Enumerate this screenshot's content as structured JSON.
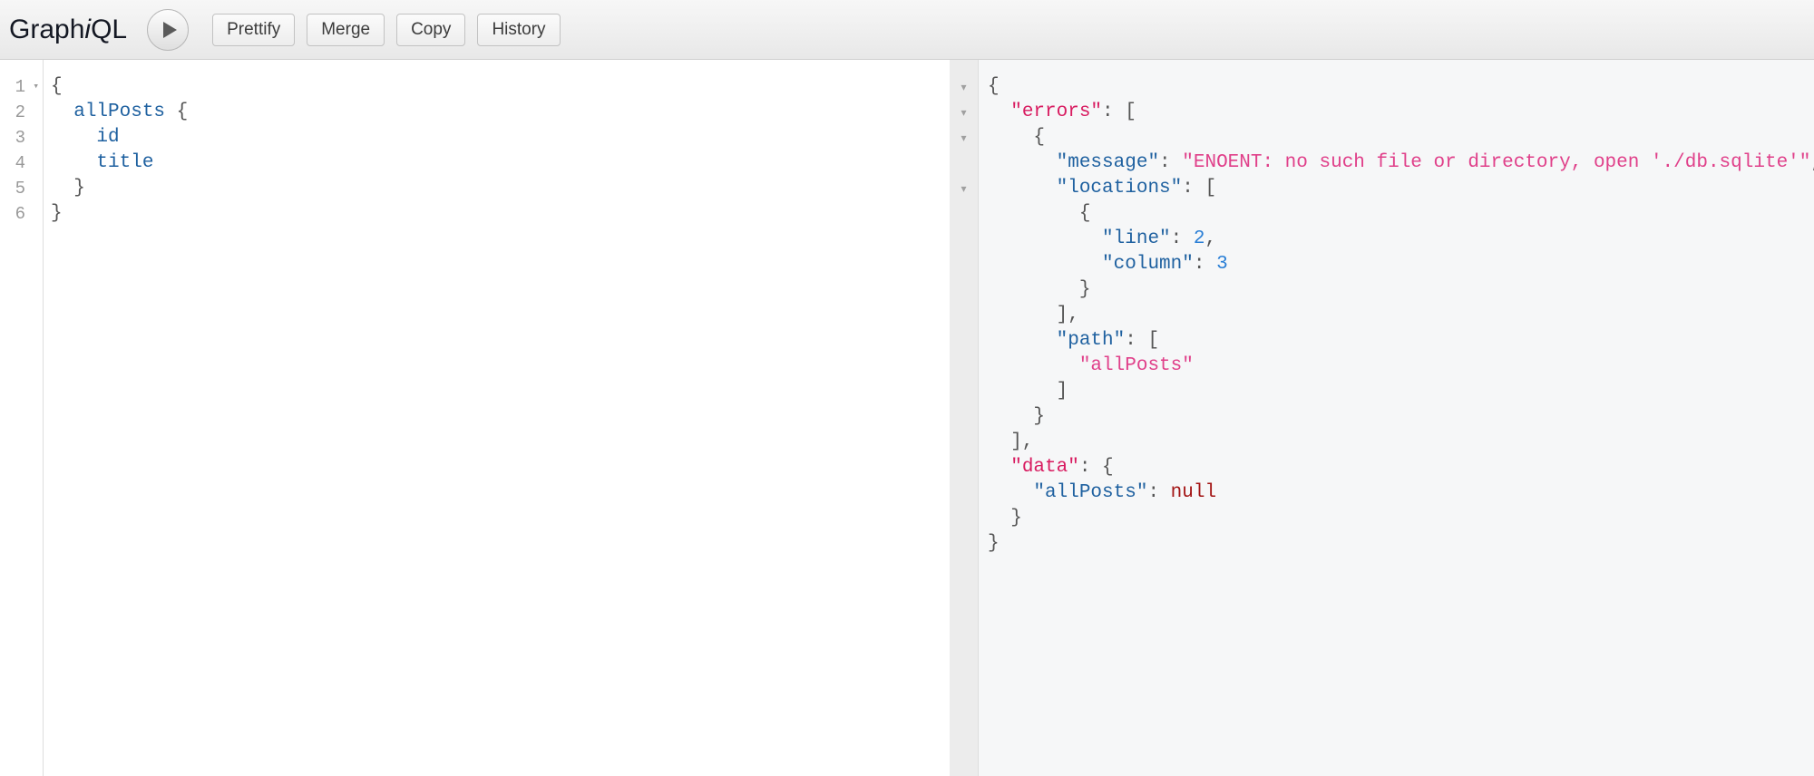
{
  "app": {
    "title": "GraphiQL",
    "title_prefix": "Graph",
    "title_italic": "i",
    "title_suffix": "QL"
  },
  "toolbar": {
    "execute_icon": "play-icon",
    "buttons": [
      {
        "label": "Prettify",
        "name": "prettify-button"
      },
      {
        "label": "Merge",
        "name": "merge-button"
      },
      {
        "label": "Copy",
        "name": "copy-button"
      },
      {
        "label": "History",
        "name": "history-button"
      }
    ]
  },
  "editor": {
    "line_numbers": [
      "1",
      "2",
      "3",
      "4",
      "5",
      "6"
    ],
    "fold_marker": "▾",
    "lines": [
      {
        "number": "1",
        "folded": true,
        "indent": "",
        "text": "{"
      },
      {
        "number": "2",
        "folded": false,
        "indent": "  ",
        "text": "allPosts {"
      },
      {
        "number": "3",
        "folded": false,
        "indent": "    ",
        "text": "id"
      },
      {
        "number": "4",
        "folded": false,
        "indent": "    ",
        "text": "title"
      },
      {
        "number": "5",
        "folded": false,
        "indent": "  ",
        "text": "}"
      },
      {
        "number": "6",
        "folded": false,
        "indent": "",
        "text": "}"
      }
    ],
    "raw": "{\n  allPosts {\n    id\n    title\n  }\n}"
  },
  "result": {
    "fold_marker": "▾",
    "fold_rows": [
      1,
      2,
      3,
      5
    ],
    "raw": "{\n  \"errors\": [\n    {\n      \"message\": \"ENOENT: no such file or directory, open './db.sqlite'\",\n      \"locations\": [\n        {\n          \"line\": 2,\n          \"column\": 3\n        }\n      ],\n      \"path\": [\n        \"allPosts\"\n      ]\n    }\n  ],\n  \"data\": {\n    \"allPosts\": null\n  }\n}",
    "lines": [
      {
        "i": 1,
        "segments": [
          {
            "t": "{",
            "c": "p"
          }
        ]
      },
      {
        "i": 2,
        "segments": [
          {
            "t": "  ",
            "c": "p"
          },
          {
            "t": "\"errors\"",
            "c": "k-top"
          },
          {
            "t": ": [",
            "c": "p"
          }
        ]
      },
      {
        "i": 3,
        "segments": [
          {
            "t": "    {",
            "c": "p"
          }
        ]
      },
      {
        "i": 4,
        "segments": [
          {
            "t": "      ",
            "c": "p"
          },
          {
            "t": "\"message\"",
            "c": "k-nest"
          },
          {
            "t": ": ",
            "c": "p"
          },
          {
            "t": "\"ENOENT: no such file or directory, open './db.sqlite'\"",
            "c": "v-str"
          },
          {
            "t": ",",
            "c": "p"
          }
        ]
      },
      {
        "i": 5,
        "segments": [
          {
            "t": "      ",
            "c": "p"
          },
          {
            "t": "\"locations\"",
            "c": "k-nest"
          },
          {
            "t": ": [",
            "c": "p"
          }
        ]
      },
      {
        "i": 6,
        "segments": [
          {
            "t": "        {",
            "c": "p"
          }
        ]
      },
      {
        "i": 7,
        "segments": [
          {
            "t": "          ",
            "c": "p"
          },
          {
            "t": "\"line\"",
            "c": "k-nest"
          },
          {
            "t": ": ",
            "c": "p"
          },
          {
            "t": "2",
            "c": "v-num"
          },
          {
            "t": ",",
            "c": "p"
          }
        ]
      },
      {
        "i": 8,
        "segments": [
          {
            "t": "          ",
            "c": "p"
          },
          {
            "t": "\"column\"",
            "c": "k-nest"
          },
          {
            "t": ": ",
            "c": "p"
          },
          {
            "t": "3",
            "c": "v-num"
          }
        ]
      },
      {
        "i": 9,
        "segments": [
          {
            "t": "        }",
            "c": "p"
          }
        ]
      },
      {
        "i": 10,
        "segments": [
          {
            "t": "      ],",
            "c": "p"
          }
        ]
      },
      {
        "i": 11,
        "segments": [
          {
            "t": "      ",
            "c": "p"
          },
          {
            "t": "\"path\"",
            "c": "k-nest"
          },
          {
            "t": ": [",
            "c": "p"
          }
        ]
      },
      {
        "i": 12,
        "segments": [
          {
            "t": "        ",
            "c": "p"
          },
          {
            "t": "\"allPosts\"",
            "c": "v-str"
          }
        ]
      },
      {
        "i": 13,
        "segments": [
          {
            "t": "      ]",
            "c": "p"
          }
        ]
      },
      {
        "i": 14,
        "segments": [
          {
            "t": "    }",
            "c": "p"
          }
        ]
      },
      {
        "i": 15,
        "segments": [
          {
            "t": "  ],",
            "c": "p"
          }
        ]
      },
      {
        "i": 16,
        "segments": [
          {
            "t": "  ",
            "c": "p"
          },
          {
            "t": "\"data\"",
            "c": "k-top"
          },
          {
            "t": ": {",
            "c": "p"
          }
        ]
      },
      {
        "i": 17,
        "segments": [
          {
            "t": "    ",
            "c": "p"
          },
          {
            "t": "\"allPosts\"",
            "c": "k-nest"
          },
          {
            "t": ": ",
            "c": "p"
          },
          {
            "t": "null",
            "c": "v-null"
          }
        ]
      },
      {
        "i": 18,
        "segments": [
          {
            "t": "  }",
            "c": "p"
          }
        ]
      },
      {
        "i": 19,
        "segments": [
          {
            "t": "}",
            "c": "p"
          }
        ]
      }
    ]
  },
  "colors": {
    "key_top": "#d81b60",
    "key_nested": "#1f61a0",
    "string": "#e0408a",
    "number": "#2a7fd6",
    "null": "#a31515",
    "punctuation": "#555555",
    "query_field": "#1f61a0",
    "result_bg": "#f6f7f8",
    "toolbar_bg": "#eeeeee"
  }
}
